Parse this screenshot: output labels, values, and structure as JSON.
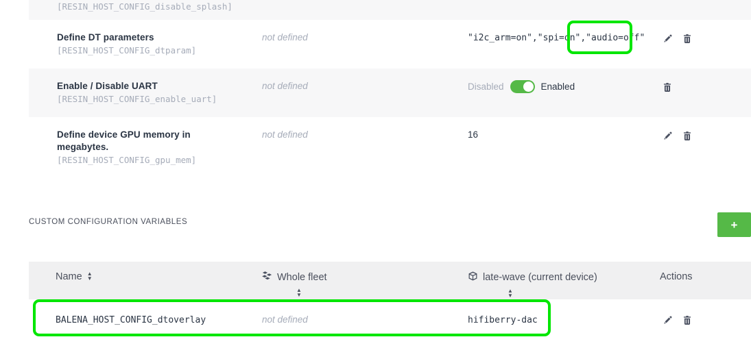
{
  "device_config": {
    "rows": [
      {
        "title": "",
        "key": "[RESIN_HOST_CONFIG_disable_splash]",
        "fleet": "",
        "value_type": "none",
        "value": "",
        "actions": []
      },
      {
        "title": "Define DT parameters",
        "key": "[RESIN_HOST_CONFIG_dtparam]",
        "fleet": "not defined",
        "value_type": "mono",
        "value": "\"i2c_arm=on\",\"spi=on\",\"audio=off\"",
        "value_head": "\"i2c_arm=on\",\"spi=on\"",
        "value_highlight": ",\"audio=off\"",
        "actions": [
          "edit-icon",
          "delete-icon"
        ]
      },
      {
        "title": "Enable / Disable UART",
        "key": "[RESIN_HOST_CONFIG_enable_uart]",
        "fleet": "not defined",
        "value_type": "toggle",
        "toggle_off_label": "Disabled",
        "toggle_on_label": "Enabled",
        "toggle_state": "on",
        "actions": [
          "delete-icon"
        ]
      },
      {
        "title": "Define device GPU memory in megabytes.",
        "key": "[RESIN_HOST_CONFIG_gpu_mem]",
        "fleet": "not defined",
        "value_type": "plain",
        "value": "16",
        "actions": [
          "edit-icon",
          "delete-icon"
        ]
      }
    ]
  },
  "custom_section": {
    "label": "CUSTOM CONFIGURATION VARIABLES",
    "add_button_label": "+"
  },
  "custom_table": {
    "headers": {
      "name": "Name",
      "fleet": "Whole fleet",
      "device": "late-wave (current device)",
      "actions": "Actions"
    },
    "icons": {
      "fleet": "fleet-cubes-icon",
      "device": "device-cube-icon",
      "sort": "sort-arrows-icon"
    },
    "rows": [
      {
        "name": "BALENA_HOST_CONFIG_dtoverlay",
        "fleet": "not defined",
        "device": "hifiberry-dac",
        "actions": [
          "edit-icon",
          "delete-icon"
        ]
      }
    ]
  },
  "annotations": {
    "highlight_color": "#00e600",
    "boxes": [
      {
        "name": "highlight-dtparam-audio-off"
      },
      {
        "name": "highlight-custom-var-row"
      }
    ]
  }
}
